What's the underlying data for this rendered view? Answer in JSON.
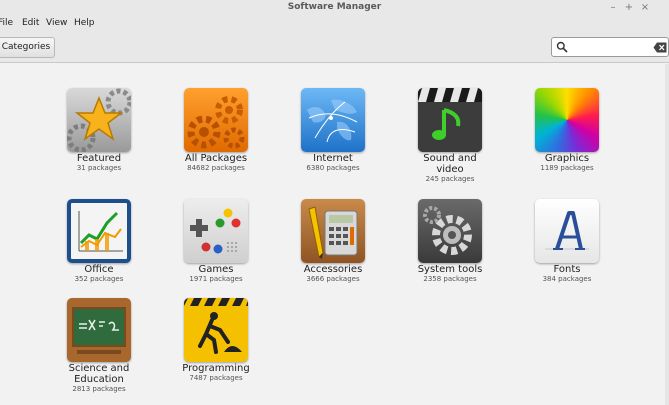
{
  "window": {
    "title": "Software Manager"
  },
  "menu": [
    "File",
    "Edit",
    "View",
    "Help"
  ],
  "toolbar": {
    "categories_label": "Categories"
  },
  "search": {
    "value": "",
    "placeholder": ""
  },
  "colors": {
    "background": "#f2f2f2",
    "chrome": "#e8e8e8"
  },
  "categories": [
    {
      "name": "Featured",
      "count": "31 packages",
      "icon": "star-icon"
    },
    {
      "name": "All Packages",
      "count": "84682 packages",
      "icon": "gears-icon"
    },
    {
      "name": "Internet",
      "count": "6380 packages",
      "icon": "globe-icon"
    },
    {
      "name": "Sound and video",
      "name_lines": [
        "Sound and",
        "video"
      ],
      "count": "245 packages",
      "icon": "music-icon"
    },
    {
      "name": "Graphics",
      "count": "1189 packages",
      "icon": "color-wheel-icon"
    },
    {
      "name": "Office",
      "count": "352 packages",
      "icon": "chart-icon"
    },
    {
      "name": "Games",
      "count": "1971 packages",
      "icon": "gamepad-icon"
    },
    {
      "name": "Accessories",
      "count": "3666 packages",
      "icon": "calculator-icon"
    },
    {
      "name": "System tools",
      "count": "2358 packages",
      "icon": "system-gear-icon"
    },
    {
      "name": "Fonts",
      "count": "384 packages",
      "icon": "font-icon"
    },
    {
      "name": "Science and Education",
      "name_lines": [
        "Science and",
        "Education"
      ],
      "count": "2813 packages",
      "icon": "chalkboard-icon"
    },
    {
      "name": "Programming",
      "count": "7487 packages",
      "icon": "construction-icon"
    }
  ]
}
